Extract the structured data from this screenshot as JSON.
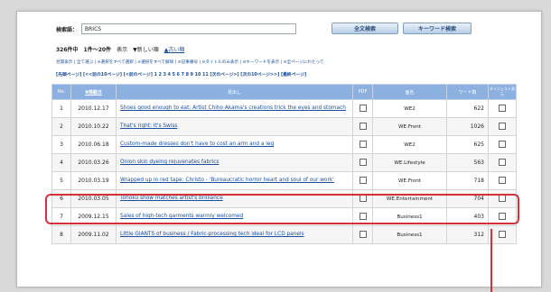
{
  "search": {
    "label": "検索語：",
    "value": "BRICS",
    "fulltext_button": "全文検索",
    "keyword_button": "キーワード検索"
  },
  "results": {
    "count": "326件中",
    "range": "1件～20件",
    "display_label": "表示",
    "order_label": "▼新しい順",
    "order_alt": "▲古い順"
  },
  "options_line": "見開表示 | 全て選ぶ | ≡選択をすべて選択 | ≡選択をすべて解除 | ≡記事番号 | ≡タイトルのみ表示 | ≡キーワードを表示 | ≡全ページにわたって",
  "pagination_line": "[先頭ページ] [<<前の10ページ] [<前のページ] 1 2 3 4 5 6 7 8 9 10 11 [次のページ>] [次の10ページ>>] [最終ページ]",
  "table": {
    "headers": [
      "No.",
      "▼掲載日",
      "見出し",
      "PDF",
      "面名",
      "ワード数",
      "ダイジェスト表示"
    ],
    "rows": [
      {
        "no": "1",
        "date": "2010.12.17",
        "title": "Shoes good enough to eat: Artist Chiho Akama's creations trick the eyes and stomach",
        "section": "WE2",
        "words": "622"
      },
      {
        "no": "2",
        "date": "2010.10.22",
        "title": "That's right: It's Swiss",
        "section": "WE.Front",
        "words": "1026"
      },
      {
        "no": "3",
        "date": "2010.06.18",
        "title": "Custom-made dresses don't have to cost an arm and a leg",
        "section": "WE2",
        "words": "625"
      },
      {
        "no": "4",
        "date": "2010.03.26",
        "title": "Onion skin dyeing rejuvenates fabrics",
        "section": "WE.Lifestyle",
        "words": "563"
      },
      {
        "no": "5",
        "date": "2010.03.19",
        "title": "Wrapped up in red tape: Christo - 'Bureaucratic horror heart and soul of our work'",
        "section": "WE.Front",
        "words": "718"
      },
      {
        "no": "6",
        "date": "2010.03.05",
        "title": "Tohoku show matches artist's brilliance",
        "section": "WE.Entertainment",
        "words": "704"
      },
      {
        "no": "7",
        "date": "2009.12.15",
        "title": "Sales of high-tech garments warmly welcomed",
        "section": "Business1",
        "words": "403"
      },
      {
        "no": "8",
        "date": "2009.11.02",
        "title": "Little GIANTS of business / Fabric-processing tech ideal for LCD panels",
        "section": "Business1",
        "words": "312"
      }
    ]
  },
  "colors": {
    "header_bg": "#8cb0df",
    "highlight": "#d6303a",
    "link": "#1a4fa0"
  }
}
